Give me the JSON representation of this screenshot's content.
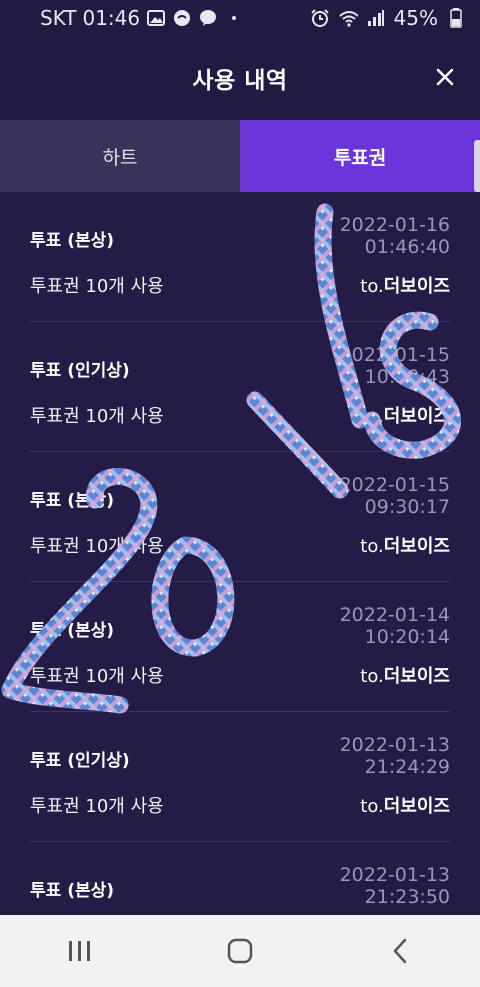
{
  "status_bar": {
    "carrier": "SKT",
    "time": "01:46",
    "battery": "45%",
    "icons": [
      "gallery-icon",
      "messenger-icon",
      "chat-icon",
      "dot-icon",
      "alarm-icon",
      "wifi-icon",
      "signal-icon",
      "battery-icon"
    ]
  },
  "header": {
    "title": "사용 내역",
    "close_icon": "close-icon"
  },
  "tabs": [
    {
      "label": "하트",
      "active": false
    },
    {
      "label": "투표권",
      "active": true
    }
  ],
  "entries": [
    {
      "type": "투표 (본상)",
      "usage": "투표권 10개 사용",
      "date": "2022-01-16",
      "time": "01:46:40",
      "to_prefix": "to.",
      "to_name": "더보이즈"
    },
    {
      "type": "투표 (인기상)",
      "usage": "투표권 10개 사용",
      "date": "2022-01-15",
      "time": "10:30:43",
      "to_prefix": "to.",
      "to_name": "더보이즈"
    },
    {
      "type": "투표 (본상)",
      "usage": "투표권 10개 사용",
      "date": "2022-01-15",
      "time": "09:30:17",
      "to_prefix": "to.",
      "to_name": "더보이즈"
    },
    {
      "type": "투표 (본상)",
      "usage": "투표권 10개 사용",
      "date": "2022-01-14",
      "time": "10:20:14",
      "to_prefix": "to.",
      "to_name": "더보이즈"
    },
    {
      "type": "투표 (인기상)",
      "usage": "투표권 10개 사용",
      "date": "2022-01-13",
      "time": "21:24:29",
      "to_prefix": "to.",
      "to_name": "더보이즈"
    },
    {
      "type": "투표 (본상)",
      "usage": "",
      "date": "2022-01-13",
      "time": "21:23:50",
      "to_prefix": "",
      "to_name": ""
    }
  ],
  "watermark": {
    "text": "2016"
  },
  "navbar": {
    "recent": "recent-apps-icon",
    "home": "home-icon",
    "back": "back-icon"
  },
  "colors": {
    "background": "#241c46",
    "header": "#221a42",
    "tab_active": "#6b34d8",
    "tab_inactive": "#3a3258",
    "date_text": "#9b95b6"
  }
}
